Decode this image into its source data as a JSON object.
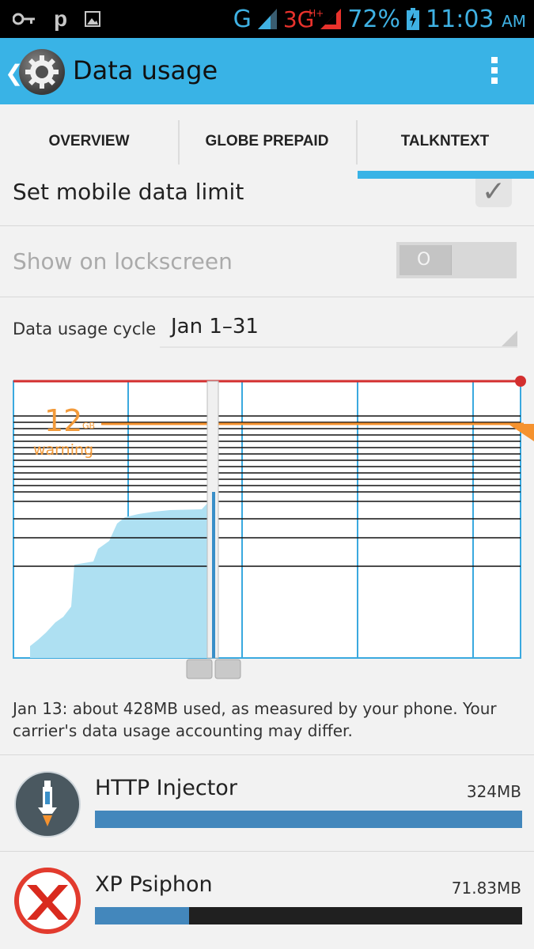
{
  "status_bar": {
    "network_type": "G",
    "data_type": "3G",
    "data_type_sup": "H+",
    "battery": "72%",
    "time": "11:03",
    "ampm": "AM",
    "left_icons": [
      "key-icon",
      "p-notification-icon",
      "image-icon"
    ],
    "notification_letter": "p"
  },
  "action_bar": {
    "title": "Data usage",
    "icon": "settings-gear-icon",
    "color": "#39b3e6"
  },
  "tabs": [
    {
      "label": "OVERVIEW",
      "active": false
    },
    {
      "label": "GLOBE PREPAID",
      "active": false
    },
    {
      "label": "TALKNTEXT",
      "active": true
    }
  ],
  "settings": {
    "mobile_limit_label": "Set mobile data limit",
    "mobile_limit_checked": true,
    "lockscreen_label": "Show on lockscreen",
    "lockscreen_on": false,
    "lockscreen_thumb": "O",
    "cycle_label": "Data usage cycle",
    "cycle_value": "Jan 1–31"
  },
  "chart": {
    "warning_value": "12",
    "warning_unit": "GB",
    "warning_label": "warning",
    "limit_color": "#d32f2f",
    "warning_color": "#f5922e",
    "usage_color": "#aee0f2"
  },
  "usage_note": "Jan 13: about 428MB used, as measured by your phone. Your carrier's data usage accounting may differ.",
  "apps": [
    {
      "name": "HTTP Injector",
      "size": "324MB",
      "fraction": 1.0,
      "icon": "syringe-icon",
      "glyph": "✉"
    },
    {
      "name": "XP Psiphon",
      "size": "71.83MB",
      "fraction": 0.22,
      "icon": "psiphon-x-icon",
      "glyph": "✕"
    }
  ]
}
